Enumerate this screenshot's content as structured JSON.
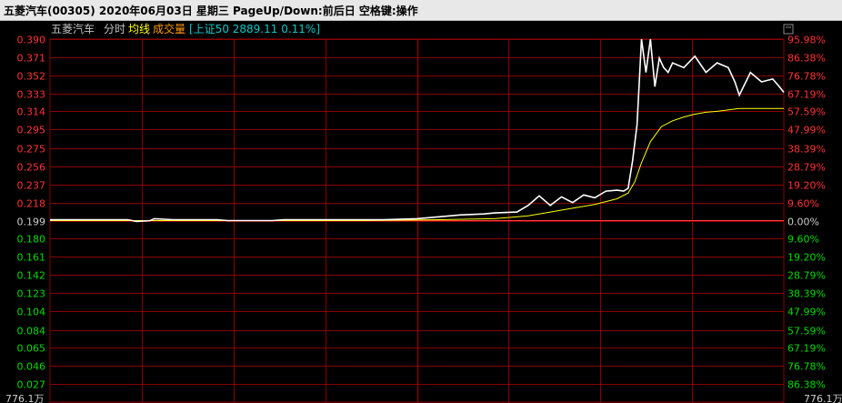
{
  "window": {
    "title": "五菱汽车(00305)  2020年06月03日  星期三  PageUp/Down:前后日  空格键:操作"
  },
  "legend": {
    "stock_name": "五菱汽车",
    "mode": "分时",
    "avg_label": "均线",
    "volume_label": "成交量",
    "index_info": "[上证50 2889.11 0.11%]",
    "close_symbol": "▯"
  },
  "colors": {
    "background": "#000000",
    "grid": "#8b0000",
    "up_text": "#ff3232",
    "down_text": "#00dc00",
    "flat_text": "#cccccc",
    "price_line": "#ffffff",
    "avg_line": "#ffff00",
    "index_line": "#ff4040",
    "index_text": "#00c8c8",
    "legend_text": "#c0c0c0"
  },
  "chart_data": {
    "type": "line",
    "prev_close": 0.199,
    "ylim": [
      0.008,
      0.39
    ],
    "price_ticks": [
      "0.390",
      "0.371",
      "0.352",
      "0.333",
      "0.314",
      "0.295",
      "0.275",
      "0.256",
      "0.237",
      "0.218",
      "0.199",
      "0.180",
      "0.161",
      "0.142",
      "0.123",
      "0.104",
      "0.084",
      "0.065",
      "0.046",
      "0.027"
    ],
    "pct_ticks": [
      "95.98%",
      "86.38%",
      "76.78%",
      "67.19%",
      "57.59%",
      "47.99%",
      "38.39%",
      "28.79%",
      "19.20%",
      "9.60%",
      "0.00%",
      "9.60%",
      "19.20%",
      "28.79%",
      "38.39%",
      "47.99%",
      "57.59%",
      "67.19%",
      "76.78%",
      "86.38%"
    ],
    "bottom_left_label": "776.1万",
    "bottom_right_label": "776.1万",
    "x_range": [
      0,
      330
    ],
    "series": [
      {
        "role": "price",
        "x": [
          0,
          35,
          39,
          45,
          47,
          55,
          60,
          75,
          80,
          100,
          105,
          130,
          140,
          150,
          165,
          175,
          185,
          195,
          200,
          210,
          215,
          220,
          225,
          230,
          235,
          240,
          245,
          250,
          255,
          258,
          260,
          262,
          264,
          266,
          268,
          270,
          272,
          274,
          276,
          278,
          280,
          285,
          290,
          295,
          300,
          305,
          308,
          310,
          315,
          320,
          325,
          328,
          330
        ],
        "values": [
          0.2,
          0.2,
          0.198,
          0.199,
          0.201,
          0.2,
          0.2,
          0.2,
          0.199,
          0.199,
          0.2,
          0.2,
          0.2,
          0.2,
          0.201,
          0.203,
          0.205,
          0.206,
          0.207,
          0.208,
          0.215,
          0.225,
          0.215,
          0.224,
          0.218,
          0.226,
          0.223,
          0.23,
          0.231,
          0.23,
          0.233,
          0.262,
          0.3,
          0.39,
          0.355,
          0.39,
          0.34,
          0.37,
          0.36,
          0.355,
          0.365,
          0.36,
          0.372,
          0.355,
          0.365,
          0.36,
          0.345,
          0.331,
          0.355,
          0.345,
          0.348,
          0.34,
          0.334
        ]
      },
      {
        "role": "average",
        "x": [
          0,
          50,
          100,
          140,
          175,
          200,
          215,
          225,
          235,
          245,
          255,
          260,
          263,
          266,
          270,
          275,
          280,
          285,
          290,
          295,
          300,
          310,
          320,
          330
        ],
        "values": [
          0.199,
          0.199,
          0.199,
          0.199,
          0.2,
          0.201,
          0.204,
          0.208,
          0.212,
          0.216,
          0.222,
          0.228,
          0.24,
          0.26,
          0.282,
          0.298,
          0.304,
          0.308,
          0.311,
          0.313,
          0.314,
          0.317,
          0.317,
          0.317
        ]
      },
      {
        "role": "index",
        "x": [
          0,
          330
        ],
        "values": [
          0.199,
          0.199
        ]
      }
    ]
  }
}
